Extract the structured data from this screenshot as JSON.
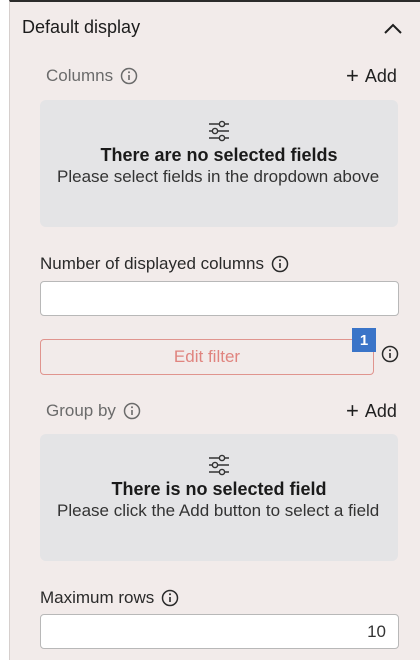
{
  "section": {
    "title": "Default display"
  },
  "columns": {
    "label": "Columns",
    "add_label": "Add",
    "empty_title": "There are no selected fields",
    "empty_desc": "Please select fields in the dropdown above"
  },
  "displayed_columns": {
    "label": "Number of displayed columns",
    "value": ""
  },
  "filter": {
    "button_label": "Edit filter",
    "count": "1"
  },
  "group_by": {
    "label": "Group by",
    "add_label": "Add",
    "empty_title": "There is no selected field",
    "empty_desc": "Please click the Add button to select a field"
  },
  "max_rows": {
    "label": "Maximum rows",
    "value": "10"
  },
  "colors": {
    "panel_bg": "#f2ebea",
    "empty_box_bg": "#e4e4e6",
    "filter_accent": "#e0847f",
    "badge_bg": "#3a74c8"
  }
}
